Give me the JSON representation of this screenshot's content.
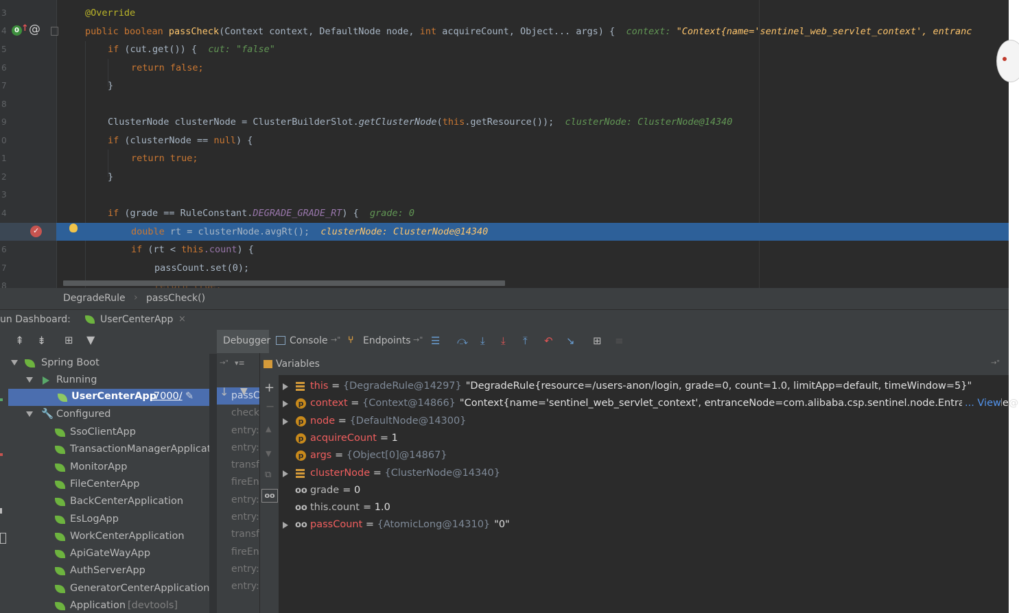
{
  "editor": {
    "line_numbers": [
      "3",
      "4",
      "5",
      "6",
      "7",
      "8",
      "9",
      "0",
      "1",
      "2",
      "3",
      "4",
      "5",
      "6",
      "7",
      "8"
    ],
    "lines": {
      "l1": {
        "annotation": "@Override"
      },
      "l2": {
        "kw1": "public boolean ",
        "fn": "passCheck",
        "rest": "(Context context, DefaultNode node, ",
        "kw2": "int",
        "rest2": " acquireCount, Object... args) {",
        "inlay": "context: ",
        "inlay_val": "\"Context{name='sentinel_web_servlet_context', entranc"
      },
      "l3": {
        "kw": "if ",
        "rest": "(cut.get()) {",
        "inlay": "cut: \"false\""
      },
      "l4": {
        "kw": "return false",
        "rest": ";"
      },
      "l5": {
        "rest": "}"
      },
      "l7": {
        "pre": "ClusterNode clusterNode = ClusterBuilderSlot.",
        "mcall": "getClusterNode",
        "mid": "(",
        "kw": "this",
        "post": ".getResource());",
        "inlay": "clusterNode: ClusterNode@14340"
      },
      "l8": {
        "kw": "if ",
        "rest": "(clusterNode == ",
        "kw2": "null",
        "rest2": ") {"
      },
      "l9": {
        "kw": "return true",
        "rest": ";"
      },
      "l10": {
        "rest": "}"
      },
      "l12": {
        "kw": "if ",
        "rest": "(grade == RuleConstant.",
        "static": "DEGRADE_GRADE_RT",
        "rest2": ") {",
        "inlay": "grade: 0"
      },
      "l13": {
        "kw": "double ",
        "rest": "rt = clusterNode.avgRt();",
        "inlay": "clusterNode: ClusterNode@14340"
      },
      "l14": {
        "kw": "if ",
        "rest": "(rt < ",
        "kw2": "this",
        "field": ".count",
        "rest2": ") {"
      },
      "l15": {
        "rest": "passCount.set(0);"
      },
      "l16": {
        "kw": "return true",
        "rest": ";"
      }
    }
  },
  "breadcrumb": {
    "class": "DegradeRule",
    "method": "passCheck()"
  },
  "dashboard": {
    "label": "un Dashboard:",
    "tab": "UserCenterApp"
  },
  "tree": {
    "spring_boot": "Spring Boot",
    "running": "Running",
    "running_app": "UserCenterApp",
    "running_port": ":7000/",
    "configured": "Configured",
    "apps": [
      "SsoClientApp",
      "TransactionManagerApplicatic",
      "MonitorApp",
      "FileCenterApp",
      "BackCenterApplication",
      "EsLogApp",
      "WorkCenterApplication",
      "ApiGateWayApp",
      "AuthServerApp",
      "GeneratorCenterApplication",
      "Application"
    ],
    "devtools": "[devtools]"
  },
  "debugger": {
    "tabs": {
      "debugger": "Debugger",
      "console": "Console",
      "endpoints": "Endpoints"
    },
    "frames": [
      "passC",
      "check",
      "entry:",
      "entry:",
      "transf",
      "fireEn",
      "entry:",
      "entry:",
      "transf",
      "fireEn",
      "entry:",
      "entry:"
    ],
    "variables_header": "Variables",
    "vars": [
      {
        "name": "this",
        "ref": "{DegradeRule@14297}",
        "value": "\"DegradeRule{resource=/users-anon/login, grade=0, count=1.0, limitApp=default, timeWindow=5}\""
      },
      {
        "name": "context",
        "ref": "{Context@14866}",
        "value": "\"Context{name='sentinel_web_servlet_context', entranceNode=com.alibaba.csp.sentinel.node.EntranceNode@",
        "view": "... View"
      },
      {
        "name": "node",
        "ref": "{DefaultNode@14300}",
        "value": ""
      },
      {
        "name": "acquireCount",
        "eq": "= 1"
      },
      {
        "name": "args",
        "ref": "{Object[0]@14867}",
        "value": ""
      },
      {
        "name": "clusterNode",
        "ref": "{ClusterNode@14340}",
        "value": ""
      },
      {
        "name": "grade",
        "eq": "= 0"
      },
      {
        "name": "this.count",
        "eq": "= 1.0"
      },
      {
        "name": "passCount",
        "ref": "{AtomicLong@14310}",
        "value": "\"0\""
      }
    ]
  },
  "colors": {
    "editor_bg": "#2b2b2b",
    "highlight": "#2d6099",
    "keyword": "#cc7832",
    "var_name": "#f05e5e"
  }
}
